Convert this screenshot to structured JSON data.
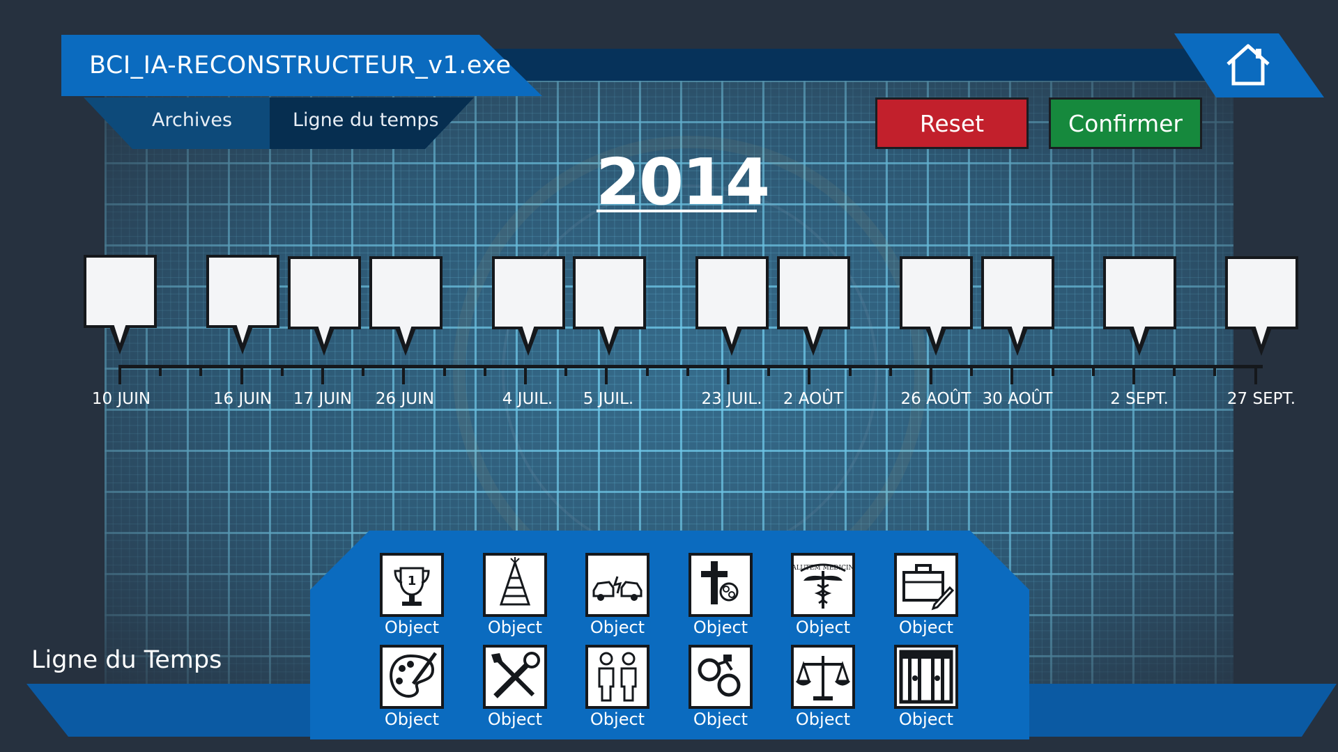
{
  "window": {
    "title": "BCI_IA-RECONSTRUCTEUR_v1.exe"
  },
  "nav": {
    "archives": "Archives",
    "ligne_du_temps": "Ligne du temps"
  },
  "buttons": {
    "reset": "Reset",
    "confirm": "Confirmer"
  },
  "colors": {
    "reset": "#c2202c",
    "confirm": "#16893d",
    "accent": "#0b6bbf"
  },
  "year": "2014",
  "timeline": {
    "dates": [
      "10 JUIN",
      "16 JUIN",
      "17 JUIN",
      "26 JUIN",
      "4 JUIL.",
      "5 JUIL.",
      "23 JUIL.",
      "2 AOÛT",
      "26 AOÛT",
      "30 AOÛT",
      "2 SEPT.",
      "27 SEPT."
    ],
    "slots_filled": 0
  },
  "footer": {
    "title": "Ligne du Temps"
  },
  "objects": [
    {
      "label": "Object",
      "icon": "trophy-icon",
      "badge": "1"
    },
    {
      "label": "Object",
      "icon": "party-hat-icon"
    },
    {
      "label": "Object",
      "icon": "car-crash-icon"
    },
    {
      "label": "Object",
      "icon": "grave-cross-icon"
    },
    {
      "label": "Object",
      "icon": "medical-caduceus-icon",
      "badge": "SALUTEM MEDICINA"
    },
    {
      "label": "Object",
      "icon": "briefcase-pen-icon"
    },
    {
      "label": "Object",
      "icon": "paint-palette-icon"
    },
    {
      "label": "Object",
      "icon": "tools-icon"
    },
    {
      "label": "Object",
      "icon": "two-people-icon"
    },
    {
      "label": "Object",
      "icon": "handcuffs-icon"
    },
    {
      "label": "Object",
      "icon": "justice-scales-icon"
    },
    {
      "label": "Object",
      "icon": "prison-bars-icon"
    }
  ]
}
